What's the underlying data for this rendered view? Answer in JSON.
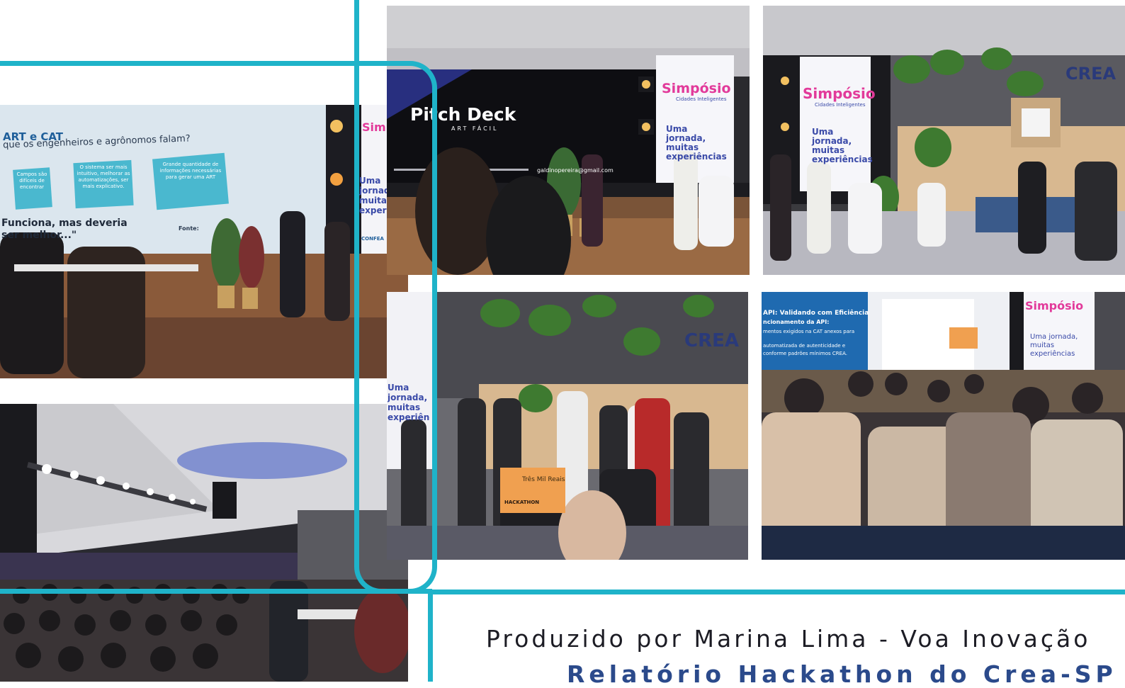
{
  "credit": {
    "text": "Produzido por Marina Lima - Voa Inovação",
    "title": "Relatório Hackathon do Crea-SP"
  },
  "slide": {
    "heading": "ART e CAT",
    "question": "que os engenheiros e agrônomos falam?",
    "cards": [
      "Campos são difíceis de encontrar",
      "O sistema ser mais intuitivo, melhorar as automatizações, ser mais explicativo.",
      "Grande quantidade de informações necessárias para gerar uma ART"
    ],
    "quote": "Funciona, mas deveria ser melhor...\"",
    "source_label": "Fonte:",
    "logo": "CONFEA"
  },
  "banner": {
    "title": "Simpósio",
    "subtitle": "Cidades Inteligentes",
    "text": "Uma jornada, muitas experiências",
    "sponsor": "CREA-SP"
  },
  "pitch": {
    "title": "Pitch Deck",
    "subtitle": "ART FÁCIL",
    "url": "galdinopereira@gmail.com"
  },
  "wall": {
    "brand": "CREA"
  },
  "check": {
    "amount": "Três Mil Reais",
    "event": "HACKATHON"
  },
  "api_slide": {
    "line1": "API: Validando com Eficiência",
    "line2": "ncionamento da API:",
    "line3": "mentos exigidos na CAT anexos para",
    "line4": "automatizada de autenticidade e",
    "line5": "conforme padrões mínimos CREA."
  },
  "colors": {
    "accent": "#1fb3c9",
    "title": "#2b4a8b",
    "credit": "#1c1c24"
  }
}
